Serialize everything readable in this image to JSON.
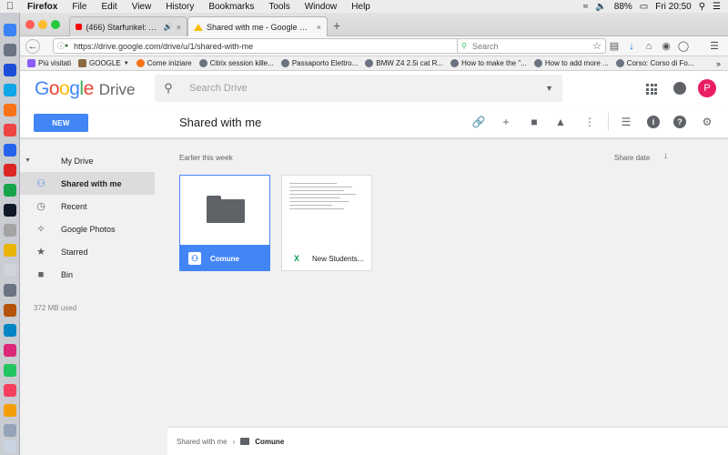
{
  "os_menu": {
    "app": "Firefox",
    "items": [
      "File",
      "Edit",
      "View",
      "History",
      "Bookmarks",
      "Tools",
      "Window",
      "Help"
    ],
    "battery": "88%",
    "clock": "Fri 20:50"
  },
  "tabs": [
    {
      "label": "(466) Starfunkel: A Mixtap...",
      "active": false
    },
    {
      "label": "Shared with me - Google Drive",
      "active": true
    }
  ],
  "browser": {
    "url": "https://drive.google.com/drive/u/1/shared-with-me",
    "search_placeholder": "Search"
  },
  "bookmarks": [
    {
      "label": "Più visitati",
      "color": "#8b5cf6"
    },
    {
      "label": "GOOGLE",
      "color": "#8b6b3d"
    },
    {
      "label": "Come iniziare",
      "color": "#f97316"
    },
    {
      "label": "Citrix session kille...",
      "color": "#6b7280"
    },
    {
      "label": "Passaporto Elettro...",
      "color": "#6b7280"
    },
    {
      "label": "BMW Z4 2.5i cat R...",
      "color": "#6b7280"
    },
    {
      "label": "How to make the \"...",
      "color": "#6b7280"
    },
    {
      "label": "How to add more ...",
      "color": "#6b7280"
    },
    {
      "label": "Corso: Corso di Fo...",
      "color": "#6b7280"
    }
  ],
  "drive": {
    "logo_word": "Google",
    "product": "Drive",
    "search_placeholder": "Search Drive",
    "avatar_letter": "P",
    "new_label": "NEW",
    "page_title": "Shared with me",
    "sidebar": [
      {
        "label": "My Drive",
        "icon": "my-drive-icon",
        "selected": false
      },
      {
        "label": "Shared with me",
        "icon": "shared-icon",
        "selected": true
      },
      {
        "label": "Recent",
        "icon": "clock-icon",
        "selected": false
      },
      {
        "label": "Google Photos",
        "icon": "photos-icon",
        "selected": false
      },
      {
        "label": "Starred",
        "icon": "star-icon",
        "selected": false
      },
      {
        "label": "Bin",
        "icon": "bin-icon",
        "selected": false
      }
    ],
    "storage": "372 MB used",
    "section_label": "Earlier this week",
    "sort_label": "Share date",
    "files": [
      {
        "name": "Comune",
        "type": "shared-folder",
        "selected": true
      },
      {
        "name": "New Students...",
        "type": "spreadsheet",
        "selected": false
      }
    ],
    "breadcrumb": {
      "root": "Shared with me",
      "current": "Comune"
    }
  },
  "colors": {
    "accent": "#4285f4",
    "avatar": "#e91e63",
    "sheets": "#0f9d58"
  }
}
